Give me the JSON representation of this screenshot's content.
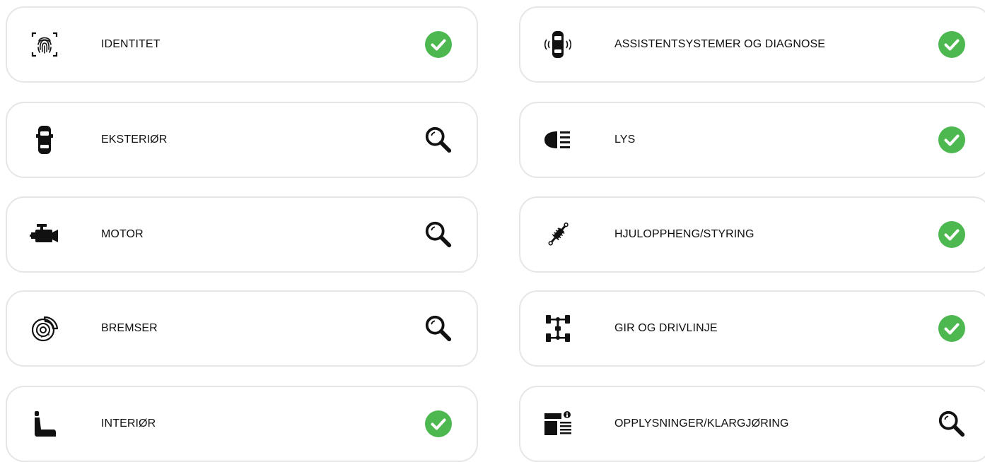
{
  "colors": {
    "check": "#4cb84f",
    "border": "#e6e6e6",
    "text": "#111111"
  },
  "categories": [
    {
      "label": "IDENTITET",
      "icon": "fingerprint-icon",
      "status": "ok"
    },
    {
      "label": "EKSTERIØR",
      "icon": "car-top-icon",
      "status": "inspect"
    },
    {
      "label": "MOTOR",
      "icon": "engine-icon",
      "status": "inspect"
    },
    {
      "label": "BREMSER",
      "icon": "brake-disc-icon",
      "status": "inspect"
    },
    {
      "label": "INTERIØR",
      "icon": "seat-icon",
      "status": "ok"
    },
    {
      "label": "ASSISTENTSYSTEMER OG DIAGNOSE",
      "icon": "car-sensor-icon",
      "status": "ok"
    },
    {
      "label": "LYS",
      "icon": "headlight-icon",
      "status": "ok"
    },
    {
      "label": "HJULOPPHENG/STYRING",
      "icon": "shock-absorber-icon",
      "status": "ok"
    },
    {
      "label": "GIR OG DRIVLINJE",
      "icon": "drivetrain-icon",
      "status": "ok"
    },
    {
      "label": "OPPLYSNINGER/KLARGJØRING",
      "icon": "info-document-icon",
      "status": "inspect"
    }
  ]
}
